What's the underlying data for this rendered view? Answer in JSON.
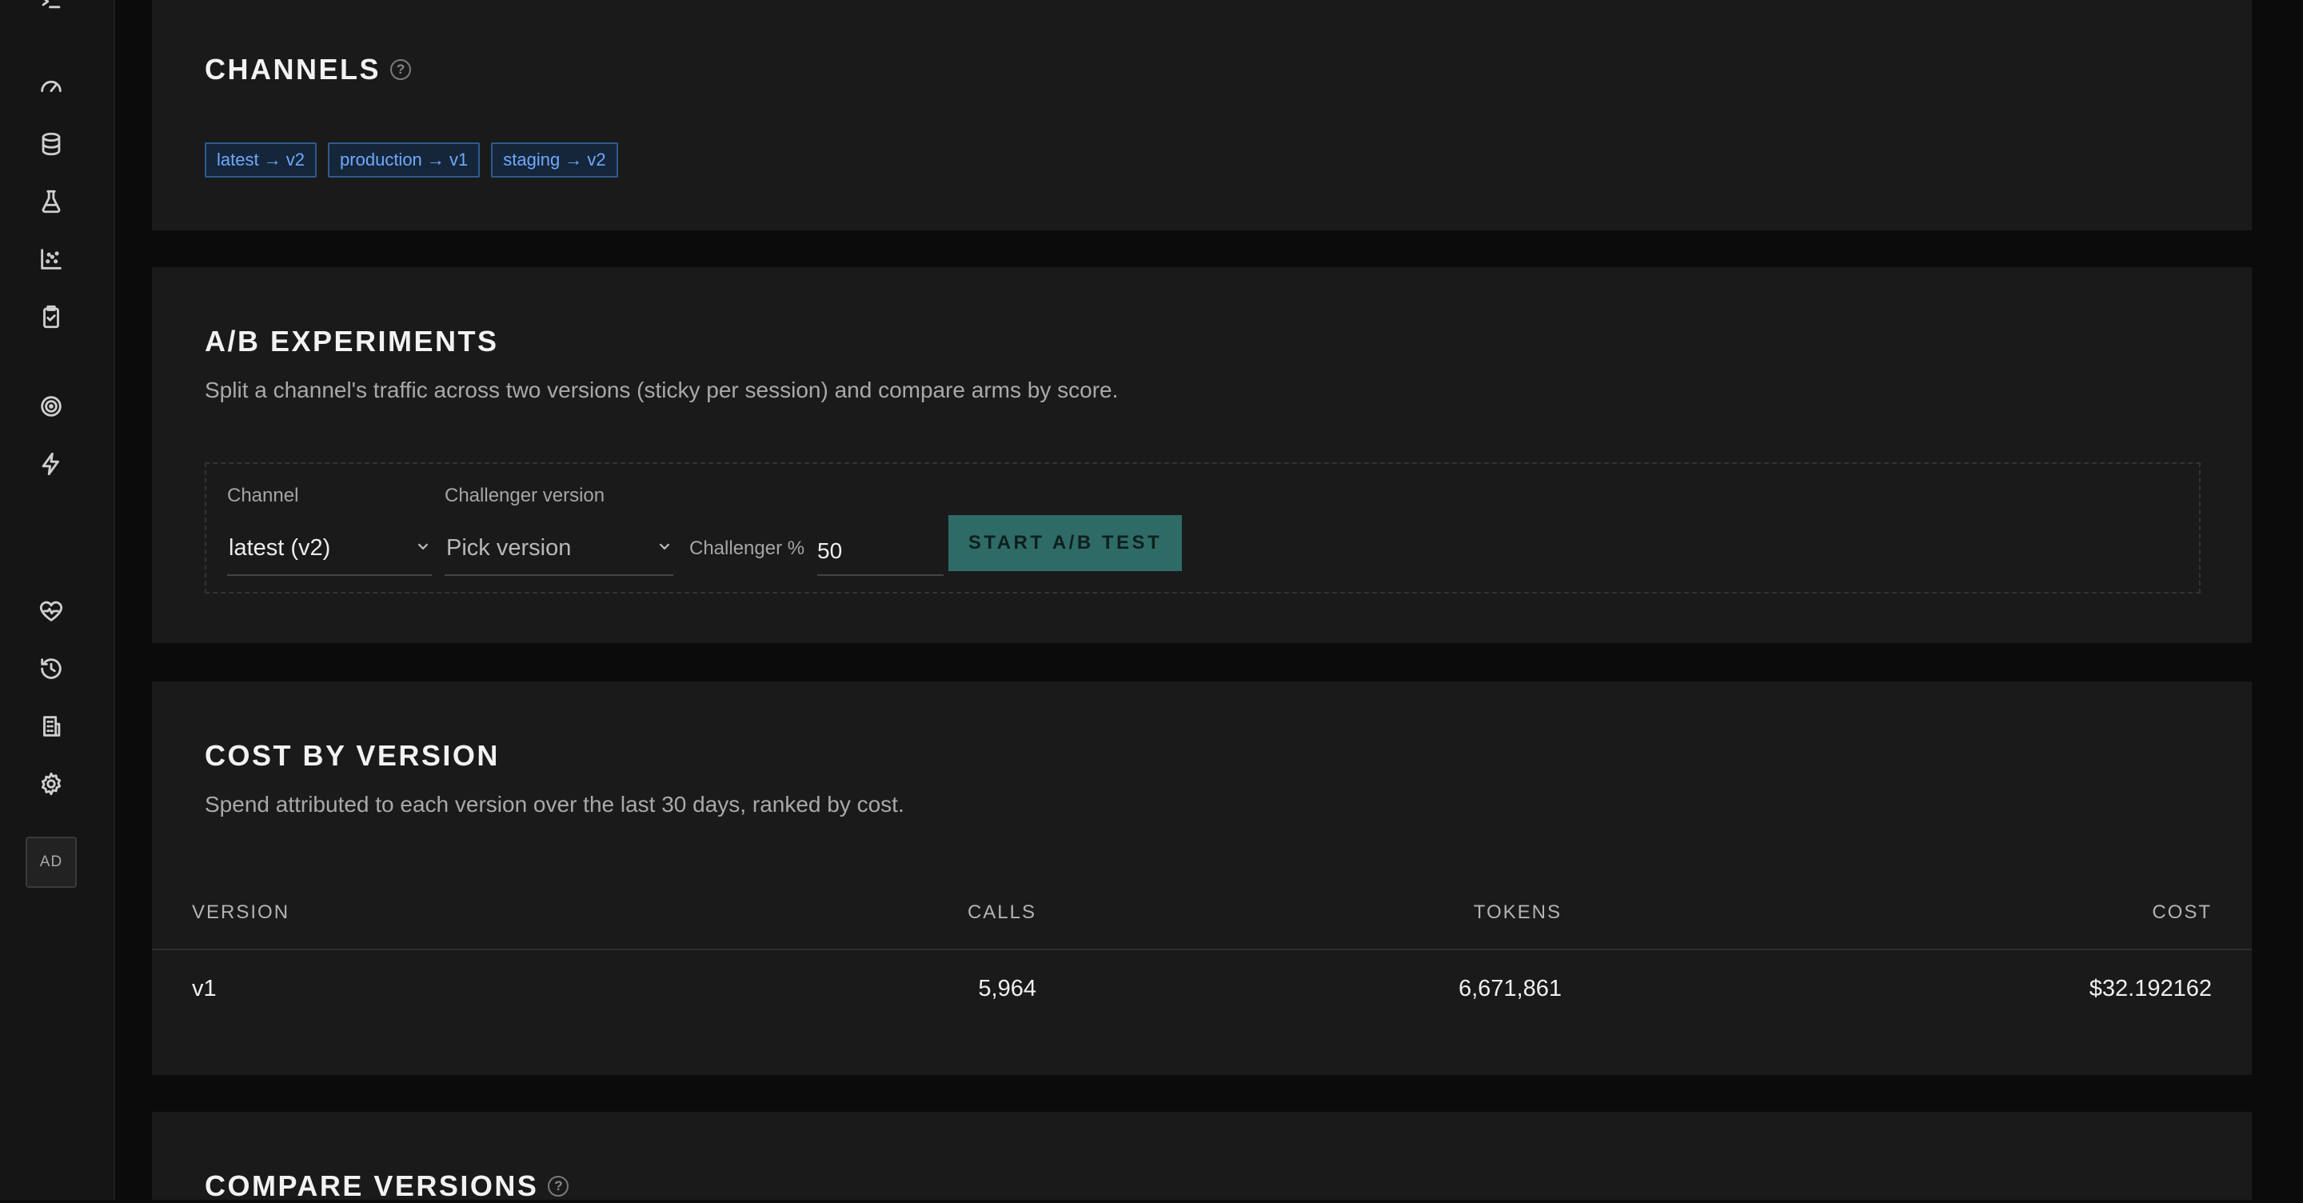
{
  "sidebar": {
    "icons": [
      "menu-icon",
      "gauge-icon",
      "database-icon",
      "flask-icon",
      "scatter-chart-icon",
      "clipboard-check-icon",
      "target-icon",
      "lightning-icon",
      "heart-pulse-icon",
      "history-icon",
      "building-icon",
      "gear-icon"
    ],
    "avatar": "AD"
  },
  "channels": {
    "title": "CHANNELS",
    "chips": [
      "latest → v2",
      "production → v1",
      "staging → v2"
    ]
  },
  "ab": {
    "title": "A/B EXPERIMENTS",
    "description": "Split a channel's traffic across two versions (sticky per session) and compare arms by score.",
    "channel_label": "Channel",
    "channel_value": "latest (v2)",
    "challenger_label": "Challenger version",
    "challenger_value": "Pick version",
    "percent_label": "Challenger %",
    "percent_value": "50",
    "start_label": "START A/B TEST"
  },
  "cost": {
    "title": "COST BY VERSION",
    "description": "Spend attributed to each version over the last 30 days, ranked by cost.",
    "columns": {
      "version": "VERSION",
      "calls": "CALLS",
      "tokens": "TOKENS",
      "cost": "COST"
    },
    "rows": [
      {
        "version": "v1",
        "calls": "5,964",
        "tokens": "6,671,861",
        "cost": "$32.192162"
      }
    ]
  },
  "compare": {
    "title": "COMPARE VERSIONS"
  },
  "colors": {
    "accent": "#2e6b66",
    "chip_text": "#6fa9ff",
    "card_bg": "#1a1a1a"
  }
}
